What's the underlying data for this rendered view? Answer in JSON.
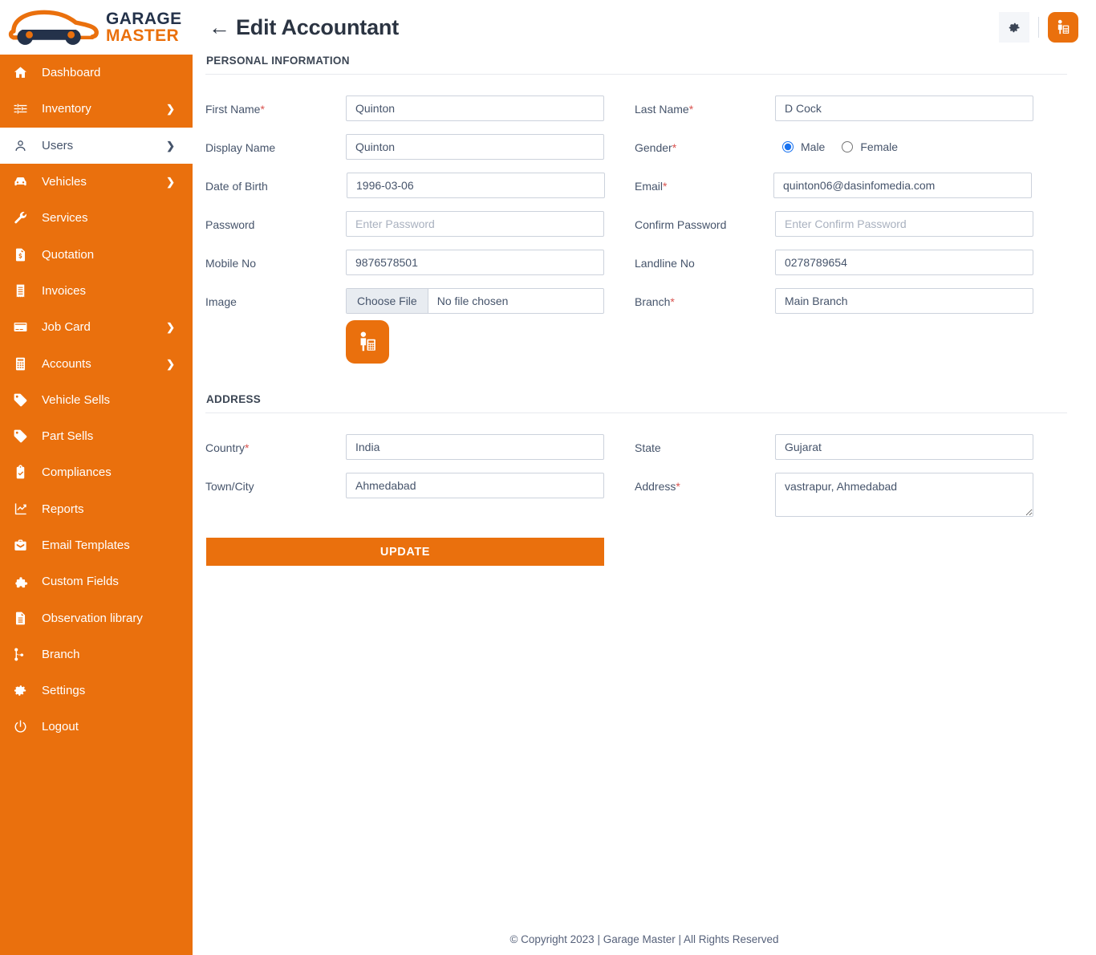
{
  "brand": {
    "logo_line1": "GARAGE",
    "logo_line2": "MASTER",
    "accent_color": "#ea700d",
    "logo_dark_color": "#24324a"
  },
  "sidebar": {
    "items": [
      {
        "label": "Dashboard",
        "icon": "home-icon",
        "caret": "",
        "active": false
      },
      {
        "label": "Inventory",
        "icon": "sliders-icon",
        "caret": "❯",
        "active": false
      },
      {
        "label": "Users",
        "icon": "user-icon",
        "caret": "❯",
        "active": true
      },
      {
        "label": "Vehicles",
        "icon": "car-icon",
        "caret": "❯",
        "active": false
      },
      {
        "label": "Services",
        "icon": "wrench-icon",
        "caret": "",
        "active": false
      },
      {
        "label": "Quotation",
        "icon": "quote-document-icon",
        "caret": "",
        "active": false
      },
      {
        "label": "Invoices",
        "icon": "receipt-icon",
        "caret": "",
        "active": false
      },
      {
        "label": "Job Card",
        "icon": "card-icon",
        "caret": "❯",
        "active": false
      },
      {
        "label": "Accounts",
        "icon": "calculator-icon",
        "caret": "❯",
        "active": false
      },
      {
        "label": "Vehicle Sells",
        "icon": "tag-icon",
        "caret": "",
        "active": false
      },
      {
        "label": "Part Sells",
        "icon": "tag-icon",
        "caret": "",
        "active": false
      },
      {
        "label": "Compliances",
        "icon": "clipboard-check-icon",
        "caret": "",
        "active": false
      },
      {
        "label": "Reports",
        "icon": "chart-line-icon",
        "caret": "",
        "active": false
      },
      {
        "label": "Email Templates",
        "icon": "envelope-icon",
        "caret": "",
        "active": false
      },
      {
        "label": "Custom Fields",
        "icon": "puzzle-icon",
        "caret": "",
        "active": false
      },
      {
        "label": "Observation library",
        "icon": "document-icon",
        "caret": "",
        "active": false
      },
      {
        "label": "Branch",
        "icon": "git-branch-icon",
        "caret": "",
        "active": false
      },
      {
        "label": "Settings",
        "icon": "gear-icon",
        "caret": "",
        "active": false
      },
      {
        "label": "Logout",
        "icon": "power-icon",
        "caret": "",
        "active": false
      }
    ]
  },
  "topbar": {
    "back_arrow": "←",
    "title": "Edit Accountant",
    "settings_icon": "gear-icon",
    "avatar_icon": "accountant-icon"
  },
  "sections": {
    "personal": {
      "heading": "PERSONAL INFORMATION",
      "first_name": {
        "label": "First Name",
        "required": "*",
        "value": "Quinton"
      },
      "last_name": {
        "label": "Last Name",
        "required": "*",
        "value": "D Cock"
      },
      "display_name": {
        "label": "Display Name",
        "required": "",
        "value": "Quinton"
      },
      "gender": {
        "label": "Gender",
        "required": "*",
        "options": [
          "Male",
          "Female"
        ],
        "selected": "Male"
      },
      "date_of_birth": {
        "label": "Date of Birth",
        "required": "",
        "value": "1996-03-06"
      },
      "email": {
        "label": "Email",
        "required": "*",
        "value": "quinton06@dasinfomedia.com"
      },
      "password": {
        "label": "Password",
        "required": "",
        "value": "",
        "placeholder": "Enter Password"
      },
      "confirm_password": {
        "label": "Confirm Password",
        "required": "",
        "value": "",
        "placeholder": "Enter Confirm Password"
      },
      "mobile_no": {
        "label": "Mobile No",
        "required": "",
        "value": "9876578501"
      },
      "landline_no": {
        "label": "Landline No",
        "required": "",
        "value": "0278789654"
      },
      "image": {
        "label": "Image",
        "required": "",
        "button": "Choose File",
        "file_status": "No file chosen",
        "thumb_icon": "accountant-icon"
      },
      "branch": {
        "label": "Branch",
        "required": "*",
        "value": "Main Branch"
      }
    },
    "address": {
      "heading": "ADDRESS",
      "country": {
        "label": "Country",
        "required": "*",
        "value": "India"
      },
      "state": {
        "label": "State",
        "required": "",
        "value": "Gujarat"
      },
      "town_city": {
        "label": "Town/City",
        "required": "",
        "value": "Ahmedabad"
      },
      "address": {
        "label": "Address",
        "required": "*",
        "value": "vastrapur, Ahmedabad"
      }
    }
  },
  "actions": {
    "update_label": "UPDATE"
  },
  "footer": {
    "text": "© Copyright 2023 | Garage Master | All Rights Reserved"
  }
}
